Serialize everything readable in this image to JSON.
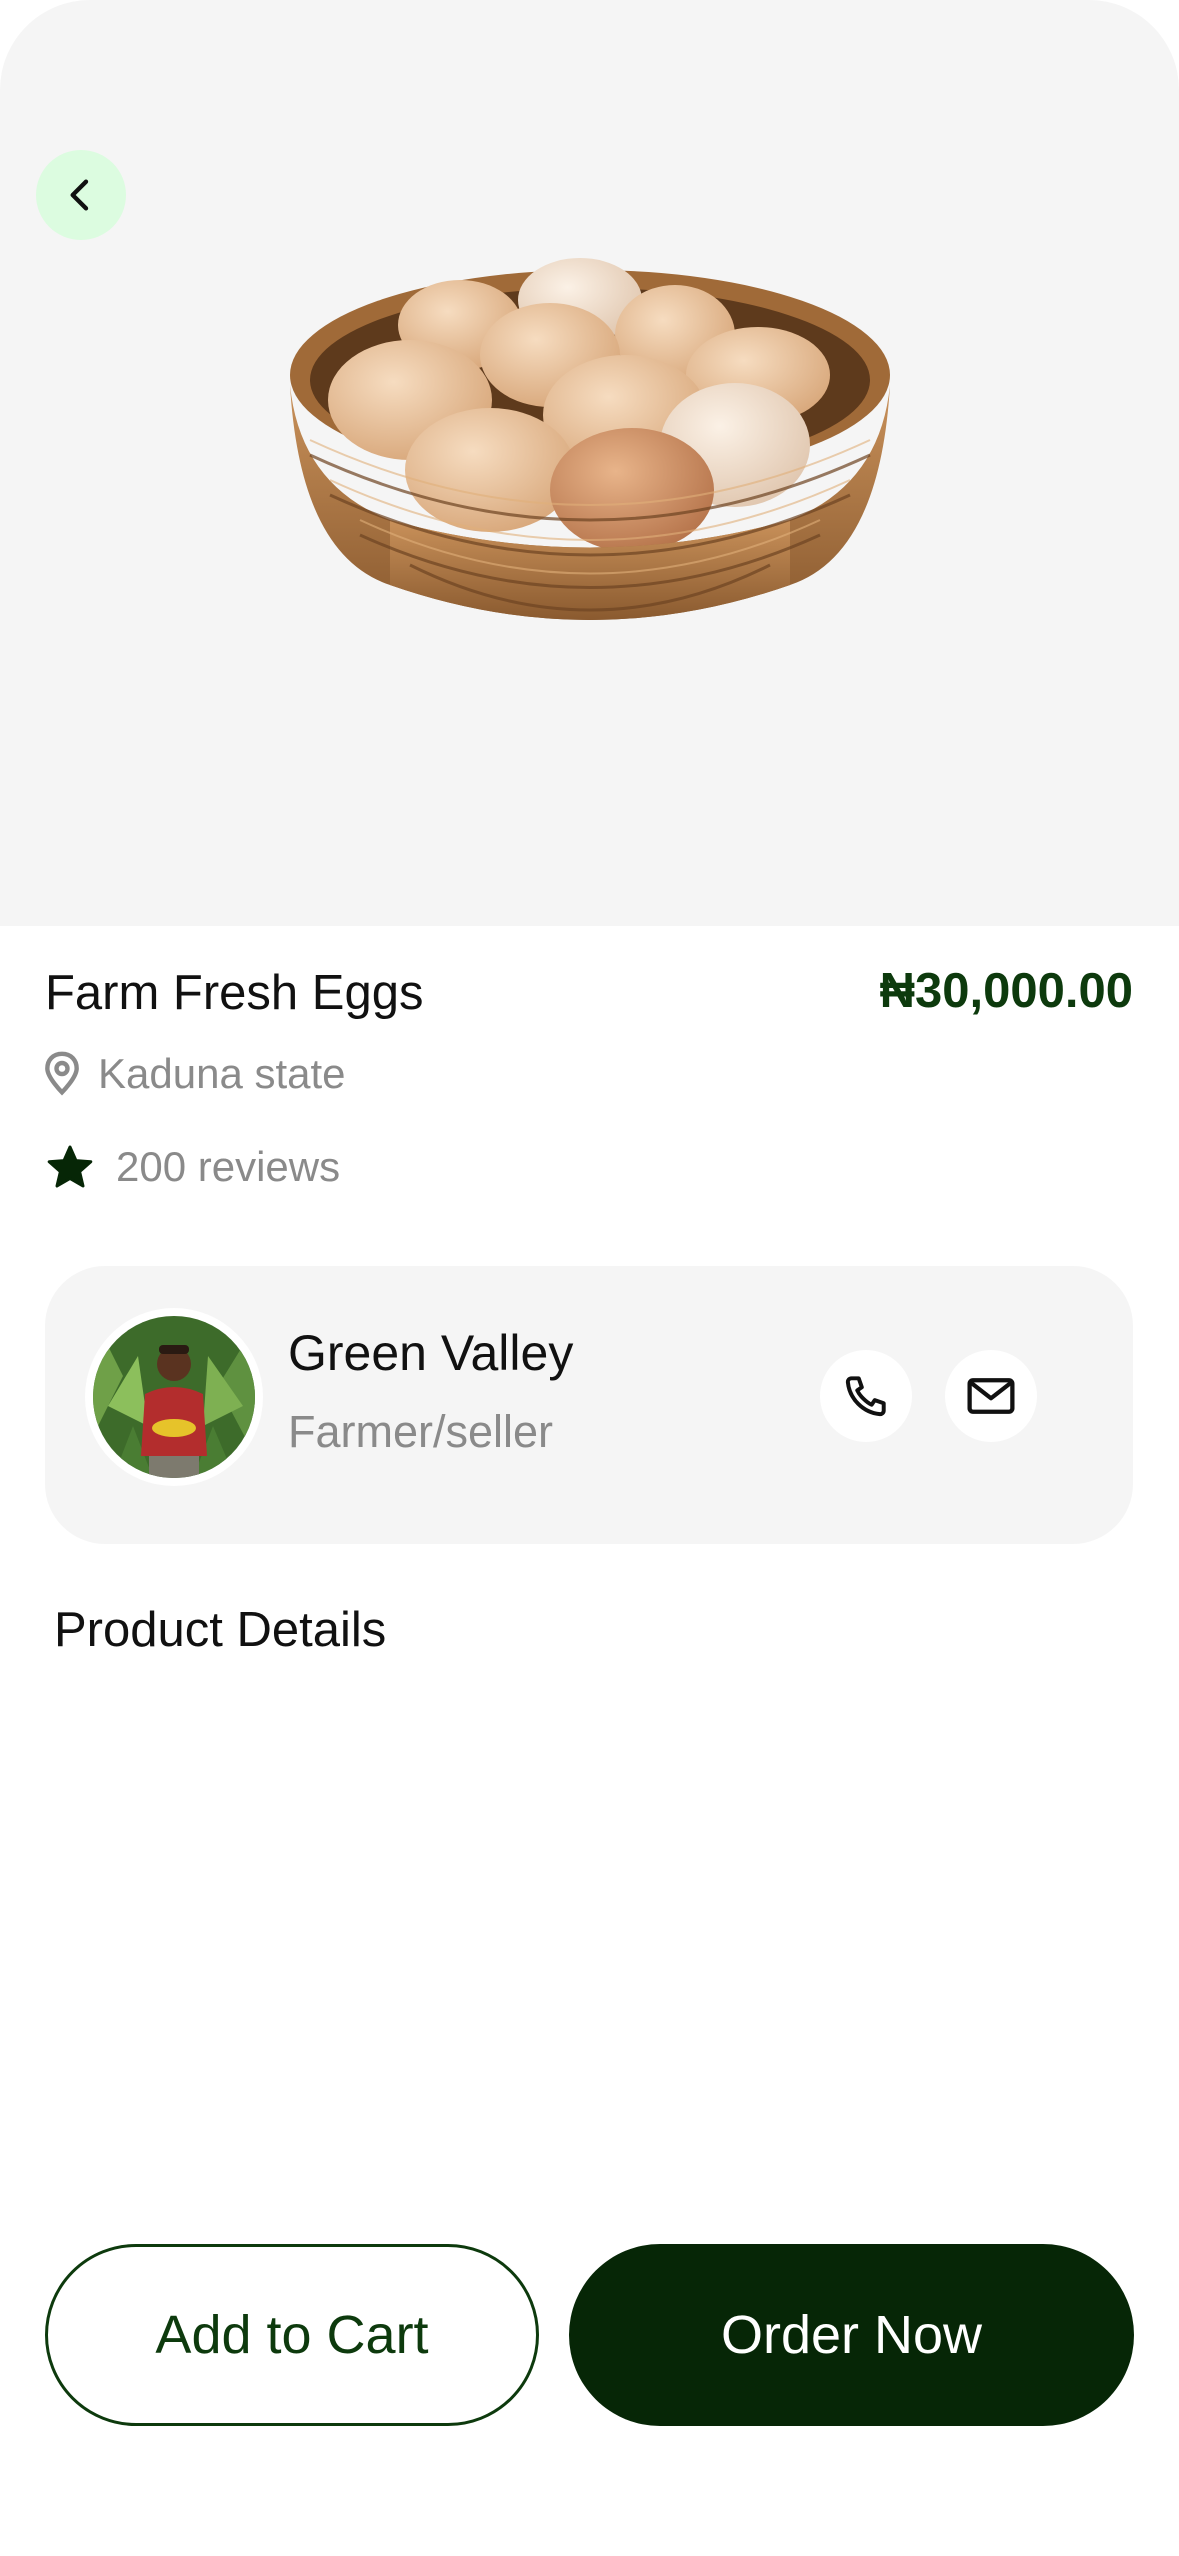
{
  "product": {
    "name": "Farm Fresh Eggs",
    "price": "₦30,000.00",
    "location": "Kaduna state",
    "reviews": "200 reviews"
  },
  "seller": {
    "name": "Green Valley",
    "role": "Farmer/seller"
  },
  "sections": {
    "details_title": "Product Details"
  },
  "actions": {
    "add_to_cart": "Add to Cart",
    "order_now": "Order Now"
  },
  "icons": {
    "back": "chevron-left-icon",
    "location": "map-pin-icon",
    "rating": "star-icon",
    "call": "phone-icon",
    "mail": "mail-icon"
  },
  "colors": {
    "brand_dark": "#062606",
    "price_green": "#0d3a0d",
    "back_button_bg": "#dcfce0",
    "card_bg": "#f5f5f5",
    "muted_text": "#8a8a8a"
  }
}
